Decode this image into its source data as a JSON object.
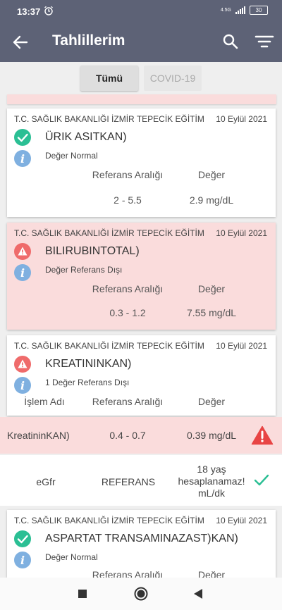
{
  "status_bar": {
    "time": "13:37",
    "network": "4.5G",
    "battery": "30"
  },
  "app_bar": {
    "title": "Tahlillerim"
  },
  "filters": {
    "tabs": [
      "Tümü",
      "COVID-19"
    ]
  },
  "cards": [
    {
      "lab": "T.C. SAĞLIK BAKANLIĞI  İZMİR TEPECİK EĞİTİM",
      "date": "10 Eylül 2021",
      "test_name": "ÜRIK ASITKAN)",
      "status_note": "Değer Normal",
      "ref_header": "Referans Aralığı",
      "value_header": "Değer",
      "ref_range": "2 - 5.5",
      "value": "2.9 mg/dL"
    },
    {
      "lab": "T.C. SAĞLIK BAKANLIĞI  İZMİR TEPECİK EĞİTİM",
      "date": "10 Eylül 2021",
      "test_name": "BILIRUBINTOTAL)",
      "status_note": "Değer Referans Dışı",
      "ref_header": "Referans Aralığı",
      "value_header": "Değer",
      "ref_range": "0.3 - 1.2",
      "value": "7.55 mg/dL"
    },
    {
      "lab": "T.C. SAĞLIK BAKANLIĞI  İZMİR TEPECİK EĞİTİM",
      "date": "10 Eylül 2021",
      "test_name": "KREATININKAN)",
      "status_note": "1 Değer Referans Dışı",
      "name_header": "İşlem Adı",
      "ref_header": "Referans Aralığı",
      "value_header": "Değer"
    },
    {
      "lab": "T.C. SAĞLIK BAKANLIĞI  İZMİR TEPECİK EĞİTİM",
      "date": "10 Eylül 2021",
      "test_name": "ASPARTAT TRANSAMINAZAST)KAN)",
      "status_note": "Değer Normal",
      "ref_header": "Referans Aralığı",
      "value_header": "Değer"
    }
  ],
  "detail_rows": [
    {
      "name": "KreatininKAN)",
      "ref": "0.4 - 0.7",
      "value": "0.39 mg/dL"
    },
    {
      "name": "eGfr",
      "ref": "REFERANS",
      "value_lines": [
        "18 yaş",
        "hesaplanamaz!",
        "mL/dk"
      ]
    }
  ],
  "colors": {
    "app_bar": "#5d6276",
    "normal_icon": "#2bbf94",
    "abnormal_icon": "#ef6b6b",
    "info_icon": "#7fb0e0",
    "alert_row": "#fadcdc",
    "alert_triangle": "#e84545"
  }
}
